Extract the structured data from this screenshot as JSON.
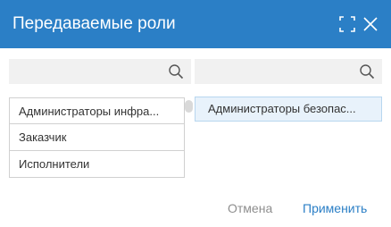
{
  "dialog": {
    "title": "Передаваемые роли",
    "icons": {
      "expand": "expand-icon",
      "close": "close-icon"
    }
  },
  "left_panel": {
    "search": {
      "value": "",
      "placeholder": "",
      "icon": "search-icon"
    },
    "items": [
      {
        "label": "Администраторы инфра..."
      },
      {
        "label": "Заказчик"
      },
      {
        "label": "Исполнители"
      }
    ]
  },
  "right_panel": {
    "search": {
      "value": "",
      "placeholder": "",
      "icon": "search-icon"
    },
    "items": [
      {
        "label": "Администраторы безопас..."
      }
    ]
  },
  "footer": {
    "cancel_label": "Отмена",
    "apply_label": "Применить"
  },
  "colors": {
    "header_bg": "#2b7fc6",
    "accent": "#2b7fc6",
    "selected_bg": "#e8f2fb",
    "muted_text": "#8e8e8e"
  }
}
